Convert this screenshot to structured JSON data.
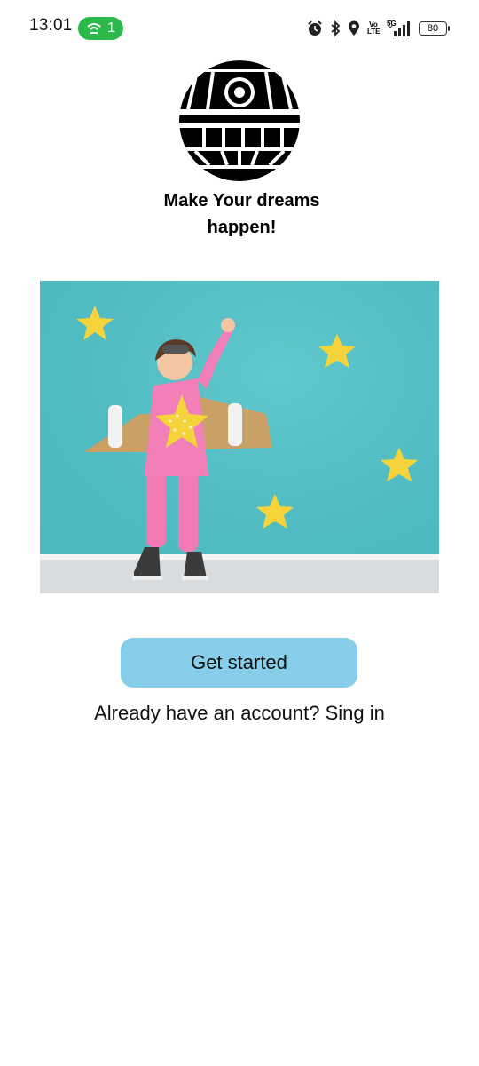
{
  "status_bar": {
    "time": "13:01",
    "hotspot_count": "1",
    "volte_label_top": "Vo",
    "volte_label_bottom": "LTE",
    "network_label": "5G",
    "battery_level": "80",
    "icons": [
      "alarm-icon",
      "bluetooth-icon",
      "location-icon",
      "volte-icon",
      "signal-5g-icon",
      "battery-icon"
    ]
  },
  "logo": {
    "icon": "death-star-logo"
  },
  "headline": "Make Your dreams happen!",
  "hero": {
    "icon": "girl-with-cardboard-wings-illustration",
    "colors": {
      "wall": "#4fc3c9",
      "floor": "#d8dcdf",
      "star": "#f5d33b"
    }
  },
  "cta": {
    "label": "Get started",
    "color": "#87ceea"
  },
  "signin": {
    "prompt": "Already have an account?",
    "link": "Sing in"
  },
  "colors": {
    "hotspot": "#2db84c"
  }
}
